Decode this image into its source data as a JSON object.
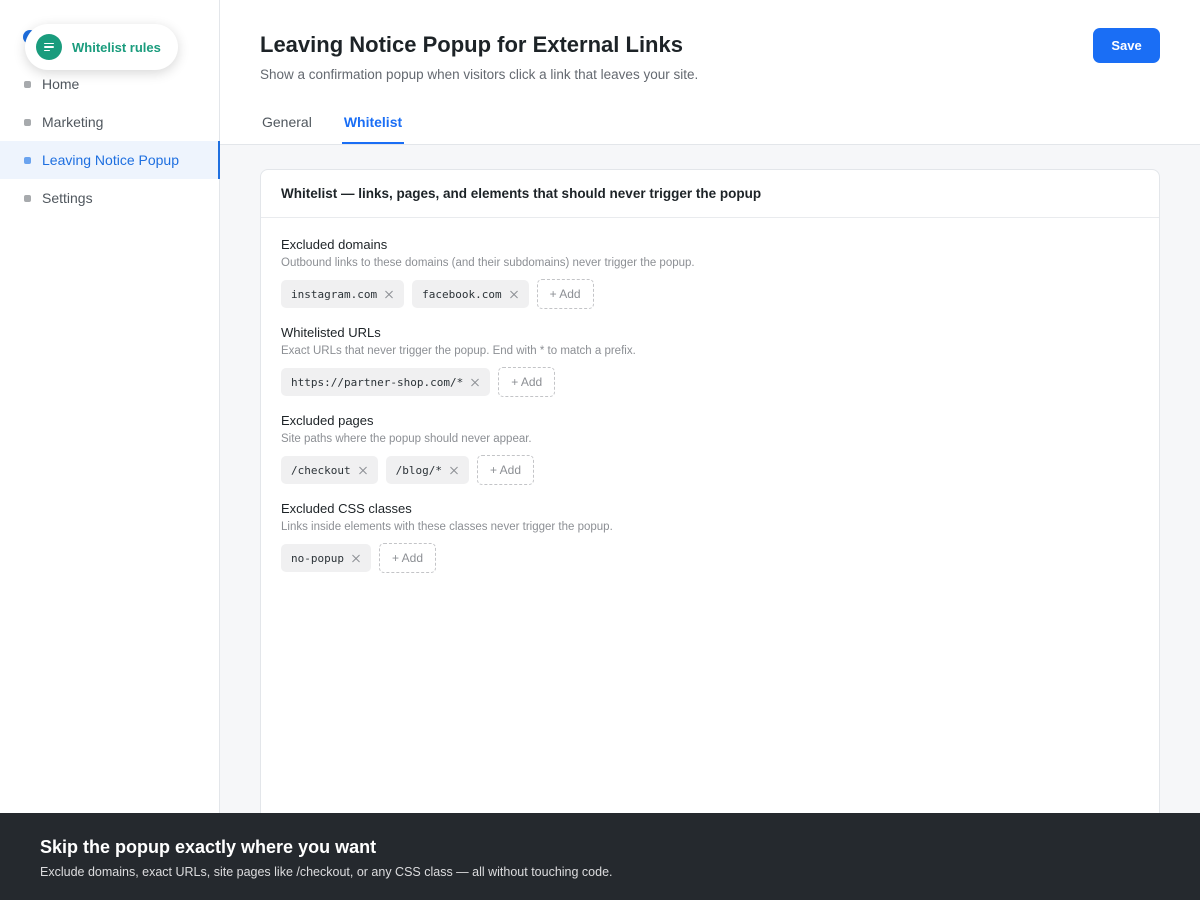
{
  "tooltip": {
    "label": "Whitelist rules",
    "icon": "list-icon"
  },
  "sidebar": {
    "items": [
      {
        "label": "Home",
        "active": false
      },
      {
        "label": "Marketing",
        "active": false
      },
      {
        "label": "Leaving Notice Popup",
        "active": true
      },
      {
        "label": "Settings",
        "active": false
      }
    ]
  },
  "header": {
    "title": "Leaving Notice Popup for External Links",
    "subtitle": "Show a confirmation popup when visitors click a link that leaves your site.",
    "save_label": "Save",
    "tabs": [
      {
        "label": "General",
        "active": false
      },
      {
        "label": "Whitelist",
        "active": true
      }
    ]
  },
  "card": {
    "title": "Whitelist — links, pages, and elements that should never trigger the popup",
    "add_label": "+ Add",
    "sections": [
      {
        "title": "Excluded domains",
        "description": "Outbound links to these domains (and their subdomains) never trigger the popup.",
        "chips": [
          "instagram.com",
          "facebook.com"
        ]
      },
      {
        "title": "Whitelisted URLs",
        "description": "Exact URLs that never trigger the popup. End with * to match a prefix.",
        "chips": [
          "https://partner-shop.com/*"
        ]
      },
      {
        "title": "Excluded pages",
        "description": "Site paths where the popup should never appear.",
        "chips": [
          "/checkout",
          "/blog/*"
        ]
      },
      {
        "title": "Excluded CSS classes",
        "description": "Links inside elements with these classes never trigger the popup.",
        "chips": [
          "no-popup"
        ]
      }
    ]
  },
  "footer": {
    "title": "Skip the popup exactly where you want",
    "subtitle": "Exclude domains, exact URLs, site pages like /checkout, or any CSS class — all without touching code."
  },
  "colors": {
    "accent": "#1a6ef5",
    "tooltip_green": "#1a9c7d",
    "footer_bg": "#25292e"
  }
}
